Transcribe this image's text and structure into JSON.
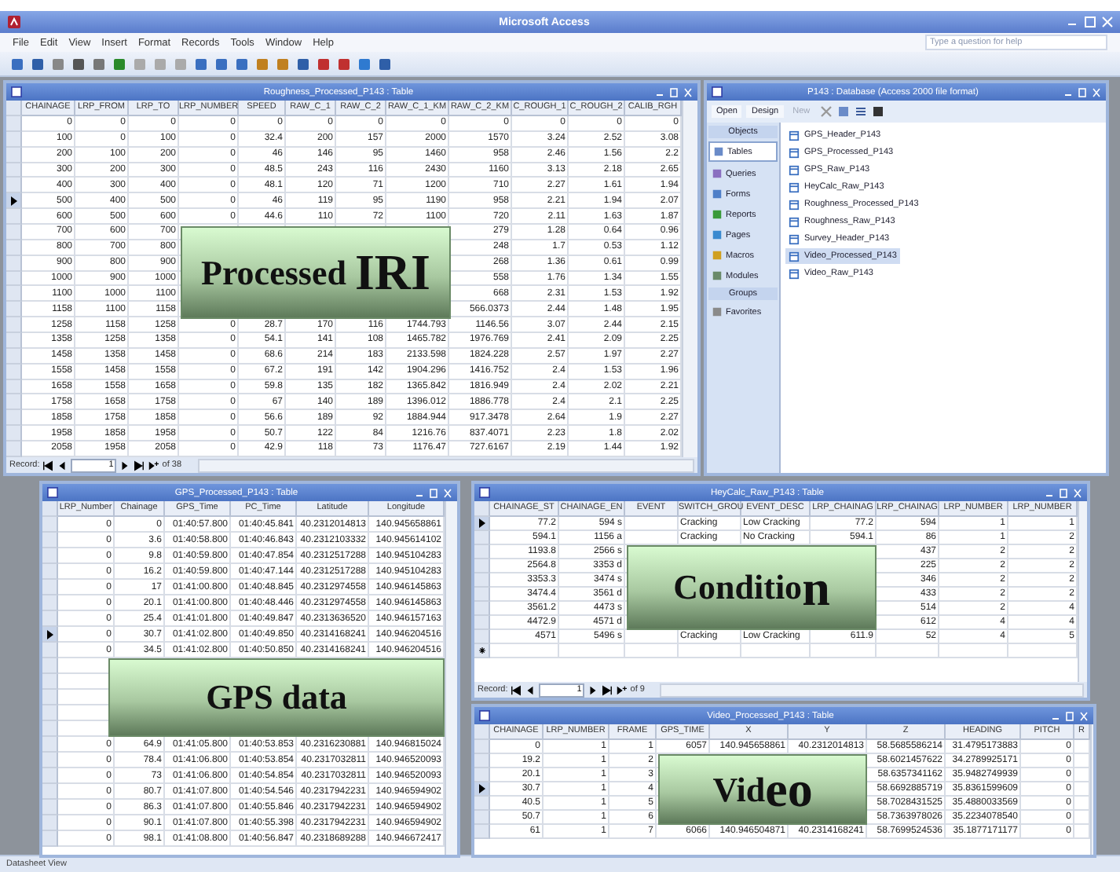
{
  "app": {
    "title": "Microsoft Access",
    "menu": [
      "File",
      "Edit",
      "View",
      "Insert",
      "Format",
      "Records",
      "Tools",
      "Window",
      "Help"
    ],
    "help_box": {
      "placeholder": "Type a question for help"
    },
    "status_bar": "Datasheet View"
  },
  "tables": [
    {
      "title": "Roughness_Processed_P143 : Table",
      "columns": [
        {
          "name": "CHAINAGE"
        },
        {
          "name": "LRP_FROM"
        },
        {
          "name": "LRP_TO"
        },
        {
          "name": "LRP_NUMBER"
        },
        {
          "name": "SPEED"
        },
        {
          "name": "RAW_C_1"
        },
        {
          "name": "RAW_C_2"
        },
        {
          "name": "RAW_C_1_KM"
        },
        {
          "name": "RAW_C_2_KM"
        },
        {
          "name": "C_ROUGH_1"
        },
        {
          "name": "C_ROUGH_2"
        },
        {
          "name": "CALIB_RGH"
        }
      ],
      "rows": [
        {
          "current": false,
          "cells": [
            "0",
            "0",
            "0",
            "0",
            "0",
            "0",
            "0",
            "0",
            "0",
            "0",
            "0",
            "0"
          ]
        },
        {
          "current": false,
          "cells": [
            "100",
            "0",
            "100",
            "0",
            "32.4",
            "200",
            "157",
            "2000",
            "1570",
            "3.24",
            "2.52",
            "3.08"
          ]
        },
        {
          "current": false,
          "cells": [
            "200",
            "100",
            "200",
            "0",
            "46",
            "146",
            "95",
            "1460",
            "958",
            "2.46",
            "1.56",
            "2.2"
          ]
        },
        {
          "current": false,
          "cells": [
            "300",
            "200",
            "300",
            "0",
            "48.5",
            "243",
            "116",
            "2430",
            "1160",
            "3.13",
            "2.18",
            "2.65"
          ]
        },
        {
          "current": false,
          "cells": [
            "400",
            "300",
            "400",
            "0",
            "48.1",
            "120",
            "71",
            "1200",
            "710",
            "2.27",
            "1.61",
            "1.94"
          ]
        },
        {
          "current": true,
          "cells": [
            "500",
            "400",
            "500",
            "0",
            "46",
            "119",
            "95",
            "1190",
            "958",
            "2.21",
            "1.94",
            "2.07"
          ]
        },
        {
          "current": false,
          "cells": [
            "600",
            "500",
            "600",
            "0",
            "44.6",
            "110",
            "72",
            "1100",
            "720",
            "2.11",
            "1.63",
            "1.87"
          ]
        },
        {
          "current": false,
          "cells": [
            "700",
            "600",
            "700",
            null,
            null,
            null,
            null,
            null,
            "279",
            "1.28",
            "0.64",
            "0.96"
          ]
        },
        {
          "current": false,
          "cells": [
            "800",
            "700",
            "800",
            null,
            null,
            null,
            null,
            null,
            "248",
            "1.7",
            "0.53",
            "1.12"
          ]
        },
        {
          "current": false,
          "cells": [
            "900",
            "800",
            "900",
            null,
            null,
            null,
            null,
            null,
            "268",
            "1.36",
            "0.61",
            "0.99"
          ]
        },
        {
          "current": false,
          "cells": [
            "1000",
            "900",
            "1000",
            null,
            null,
            null,
            null,
            null,
            "558",
            "1.76",
            "1.34",
            "1.55"
          ]
        },
        {
          "current": false,
          "cells": [
            "1100",
            "1000",
            "1100",
            null,
            null,
            null,
            null,
            null,
            "668",
            "2.31",
            "1.53",
            "1.92"
          ]
        },
        {
          "current": false,
          "cells": [
            "1158",
            "1100",
            "1158",
            null,
            null,
            null,
            null,
            null,
            "566.0373",
            "2.44",
            "1.48",
            "1.95"
          ]
        },
        {
          "current": false,
          "cells": [
            "1258",
            "1158",
            "1258",
            "0",
            "28.7",
            "170",
            "116",
            "1744.793",
            "1146.56",
            "3.07",
            "2.44",
            "2.15"
          ]
        },
        {
          "current": false,
          "cells": [
            "1358",
            "1258",
            "1358",
            "0",
            "54.1",
            "141",
            "108",
            "1465.782",
            "1976.769",
            "2.41",
            "2.09",
            "2.25"
          ]
        },
        {
          "current": false,
          "cells": [
            "1458",
            "1358",
            "1458",
            "0",
            "68.6",
            "214",
            "183",
            "2133.598",
            "1824.228",
            "2.57",
            "1.97",
            "2.27"
          ]
        },
        {
          "current": false,
          "cells": [
            "1558",
            "1458",
            "1558",
            "0",
            "67.2",
            "191",
            "142",
            "1904.296",
            "1416.752",
            "2.4",
            "1.53",
            "1.96"
          ]
        },
        {
          "current": false,
          "cells": [
            "1658",
            "1558",
            "1658",
            "0",
            "59.8",
            "135",
            "182",
            "1365.842",
            "1816.949",
            "2.4",
            "2.02",
            "2.21"
          ]
        },
        {
          "current": false,
          "cells": [
            "1758",
            "1658",
            "1758",
            "0",
            "67",
            "140",
            "189",
            "1396.012",
            "1886.778",
            "2.4",
            "2.1",
            "2.25"
          ]
        },
        {
          "current": false,
          "cells": [
            "1858",
            "1758",
            "1858",
            "0",
            "56.6",
            "189",
            "92",
            "1884.944",
            "917.3478",
            "2.64",
            "1.9",
            "2.27"
          ]
        },
        {
          "current": false,
          "cells": [
            "1958",
            "1858",
            "1958",
            "0",
            "50.7",
            "122",
            "84",
            "1216.76",
            "837.4071",
            "2.23",
            "1.8",
            "2.02"
          ]
        },
        {
          "current": false,
          "cells": [
            "2058",
            "1958",
            "2058",
            "0",
            "42.9",
            "118",
            "73",
            "1176.47",
            "727.6167",
            "2.19",
            "1.44",
            "1.92"
          ]
        }
      ],
      "navigator": {
        "label": "Record:",
        "current": "1",
        "total": "of 38"
      }
    },
    {
      "title": "GPS_Processed_P143 : Table",
      "columns": [
        {
          "name": "LRP_Number"
        },
        {
          "name": "Chainage"
        },
        {
          "name": "GPS_Time"
        },
        {
          "name": "PC_Time"
        },
        {
          "name": "Latitude"
        },
        {
          "name": "Longitude"
        }
      ],
      "rows": [
        {
          "current": false,
          "cells": [
            "0",
            "0",
            "01:40:57.800",
            "01:40:45.841",
            "40.2312014813",
            "140.945658861"
          ]
        },
        {
          "current": false,
          "cells": [
            "0",
            "3.6",
            "01:40:58.800",
            "01:40:46.843",
            "40.2312103332",
            "140.945614102"
          ]
        },
        {
          "current": false,
          "cells": [
            "0",
            "9.8",
            "01:40:59.800",
            "01:40:47.854",
            "40.2312517288",
            "140.945104283"
          ]
        },
        {
          "current": false,
          "cells": [
            "0",
            "16.2",
            "01:40:59.800",
            "01:40:47.144",
            "40.2312517288",
            "140.945104283"
          ]
        },
        {
          "current": false,
          "cells": [
            "0",
            "17",
            "01:41:00.800",
            "01:40:48.845",
            "40.2312974558",
            "140.946145863"
          ]
        },
        {
          "current": false,
          "cells": [
            "0",
            "20.1",
            "01:41:00.800",
            "01:40:48.446",
            "40.2312974558",
            "140.946145863"
          ]
        },
        {
          "current": false,
          "cells": [
            "0",
            "25.4",
            "01:41:01.800",
            "01:40:49.847",
            "40.2313636520",
            "140.946157163"
          ]
        },
        {
          "current": true,
          "cells": [
            "0",
            "30.7",
            "01:41:02.800",
            "01:40:49.850",
            "40.2314168241",
            "140.946204516"
          ]
        },
        {
          "current": false,
          "cells": [
            "0",
            "34.5",
            "01:41:02.800",
            "01:40:50.850",
            "40.2314168241",
            "140.946204516"
          ]
        },
        {
          "current": false,
          "cells": [
            null,
            null,
            null,
            null,
            null,
            null
          ]
        },
        {
          "current": false,
          "cells": [
            null,
            null,
            null,
            null,
            null,
            null
          ]
        },
        {
          "current": false,
          "cells": [
            null,
            null,
            null,
            null,
            null,
            null
          ]
        },
        {
          "current": false,
          "cells": [
            null,
            null,
            null,
            null,
            null,
            null
          ]
        },
        {
          "current": false,
          "cells": [
            null,
            null,
            null,
            null,
            null,
            null
          ]
        },
        {
          "current": false,
          "cells": [
            "0",
            "64.9",
            "01:41:05.800",
            "01:40:53.853",
            "40.2316230881",
            "140.946815024"
          ]
        },
        {
          "current": false,
          "cells": [
            "0",
            "78.4",
            "01:41:06.800",
            "01:40:53.854",
            "40.2317032811",
            "140.946520093"
          ]
        },
        {
          "current": false,
          "cells": [
            "0",
            "73",
            "01:41:06.800",
            "01:40:54.854",
            "40.2317032811",
            "140.946520093"
          ]
        },
        {
          "current": false,
          "cells": [
            "0",
            "80.7",
            "01:41:07.800",
            "01:40:54.546",
            "40.2317942231",
            "140.946594902"
          ]
        },
        {
          "current": false,
          "cells": [
            "0",
            "86.3",
            "01:41:07.800",
            "01:40:55.846",
            "40.2317942231",
            "140.946594902"
          ]
        },
        {
          "current": false,
          "cells": [
            "0",
            "90.1",
            "01:41:07.800",
            "01:40:55.398",
            "40.2317942231",
            "140.946594902"
          ]
        },
        {
          "current": false,
          "cells": [
            "0",
            "98.1",
            "01:41:08.800",
            "01:40:56.847",
            "40.2318689288",
            "140.946672417"
          ]
        }
      ]
    },
    {
      "title": "HeyCalc_Raw_P143 : Table",
      "columns": [
        {
          "name": "CHAINAGE_ST"
        },
        {
          "name": "CHAINAGE_EN"
        },
        {
          "name": "EVENT"
        },
        {
          "name": "SWITCH_GROU"
        },
        {
          "name": "EVENT_DESC"
        },
        {
          "name": "LRP_CHAINAG"
        },
        {
          "name": "LRP_CHAINAG"
        },
        {
          "name": "LRP_NUMBER"
        },
        {
          "name": "LRP_NUMBER"
        }
      ],
      "rows": [
        {
          "current": true,
          "cells": [
            "77.2",
            "594 s",
            null,
            "Cracking",
            "Low Cracking",
            "77.2",
            "594",
            "1",
            "1"
          ]
        },
        {
          "current": false,
          "cells": [
            "594.1",
            "1156 a",
            null,
            "Cracking",
            "No Cracking",
            "594.1",
            "86",
            "1",
            "2"
          ]
        },
        {
          "current": false,
          "cells": [
            "1193.8",
            "2566 s",
            null,
            null,
            null,
            null,
            "437",
            "2",
            "2"
          ]
        },
        {
          "current": false,
          "cells": [
            "2564.8",
            "3353 d",
            null,
            null,
            null,
            null,
            "225",
            "2",
            "2"
          ]
        },
        {
          "current": false,
          "cells": [
            "3353.3",
            "3474 s",
            null,
            null,
            null,
            null,
            "346",
            "2",
            "2"
          ]
        },
        {
          "current": false,
          "cells": [
            "3474.4",
            "3561 d",
            null,
            null,
            null,
            null,
            "433",
            "2",
            "2"
          ]
        },
        {
          "current": false,
          "cells": [
            "3561.2",
            "4473 s",
            null,
            null,
            null,
            null,
            "514",
            "2",
            "4"
          ]
        },
        {
          "current": false,
          "cells": [
            "4472.9",
            "4571 d",
            null,
            null,
            null,
            null,
            "612",
            "4",
            "4"
          ]
        },
        {
          "current": false,
          "cells": [
            "4571",
            "5496 s",
            null,
            "Cracking",
            "Low Cracking",
            "611.9",
            "52",
            "4",
            "5"
          ]
        }
      ],
      "new_record_row": true,
      "navigator": {
        "label": "Record:",
        "current": "1",
        "total": "of 9"
      }
    },
    {
      "title": "Video_Processed_P143 : Table",
      "columns": [
        {
          "name": "CHAINAGE"
        },
        {
          "name": "LRP_NUMBER"
        },
        {
          "name": "FRAME"
        },
        {
          "name": "GPS_TIME"
        },
        {
          "name": "X"
        },
        {
          "name": "Y"
        },
        {
          "name": "Z"
        },
        {
          "name": "HEADING"
        },
        {
          "name": "PITCH"
        },
        {
          "name": "R"
        }
      ],
      "rows": [
        {
          "current": false,
          "cells": [
            "0",
            "1",
            "1",
            "6057",
            "140.945658861",
            "40.2312014813",
            "58.5685586214",
            "31.4795173883",
            "0",
            null
          ]
        },
        {
          "current": false,
          "cells": [
            "19.2",
            "1",
            "2",
            null,
            null,
            null,
            "58.6021457622",
            "34.2789925171",
            "0",
            null
          ]
        },
        {
          "current": false,
          "cells": [
            "20.1",
            "1",
            "3",
            null,
            null,
            null,
            "58.6357341162",
            "35.9482749939",
            "0",
            null
          ]
        },
        {
          "current": true,
          "cells": [
            "30.7",
            "1",
            "4",
            null,
            null,
            null,
            "58.6692885719",
            "35.8361599609",
            "0",
            null
          ]
        },
        {
          "current": false,
          "cells": [
            "40.5",
            "1",
            "5",
            null,
            null,
            null,
            "58.7028431525",
            "35.4880033569",
            "0",
            null
          ]
        },
        {
          "current": false,
          "cells": [
            "50.7",
            "1",
            "6",
            null,
            null,
            null,
            "58.7363978026",
            "35.2234078540",
            "0",
            null
          ]
        },
        {
          "current": false,
          "cells": [
            "61",
            "1",
            "7",
            "6066",
            "140.946504871",
            "40.2314168241",
            "58.7699524536",
            "35.1877171177",
            "0",
            null
          ]
        }
      ]
    }
  ],
  "database": {
    "title": "P143 : Database (Access 2000 file format)",
    "toolbar": [
      {
        "label": "Open",
        "disabled": false
      },
      {
        "label": "Design",
        "disabled": false
      },
      {
        "label": "New",
        "disabled": true
      }
    ],
    "groups": [
      {
        "label": "Objects",
        "items": [
          {
            "label": "Tables",
            "selected": true
          },
          {
            "label": "Queries",
            "selected": false
          },
          {
            "label": "Forms",
            "selected": false
          },
          {
            "label": "Reports",
            "selected": false
          },
          {
            "label": "Pages",
            "selected": false
          },
          {
            "label": "Macros",
            "selected": false
          },
          {
            "label": "Modules",
            "selected": false
          }
        ]
      },
      {
        "label": "Groups",
        "items": [
          {
            "label": "Favorites",
            "selected": false
          }
        ]
      }
    ],
    "objects": [
      {
        "label": "GPS_Header_P143",
        "selected": false
      },
      {
        "label": "GPS_Processed_P143",
        "selected": false
      },
      {
        "label": "GPS_Raw_P143",
        "selected": false
      },
      {
        "label": "HeyCalc_Raw_P143",
        "selected": false
      },
      {
        "label": "Roughness_Processed_P143",
        "selected": false
      },
      {
        "label": "Roughness_Raw_P143",
        "selected": false
      },
      {
        "label": "Survey_Header_P143",
        "selected": false
      },
      {
        "label": "Video_Processed_P143",
        "selected": true
      },
      {
        "label": "Video_Raw_P143",
        "selected": false
      }
    ]
  },
  "labels": [
    {
      "parts": [
        {
          "text": "Processed ",
          "large": false
        },
        {
          "text": "IRI",
          "large": true
        }
      ]
    },
    {
      "parts": [
        {
          "text": "GPS data",
          "large": false
        }
      ]
    },
    {
      "parts": [
        {
          "text": "Conditio",
          "large": false
        },
        {
          "text": "n",
          "large": true
        }
      ]
    },
    {
      "parts": [
        {
          "text": "Vid",
          "large": false
        },
        {
          "text": "eo",
          "large": true
        }
      ]
    }
  ]
}
